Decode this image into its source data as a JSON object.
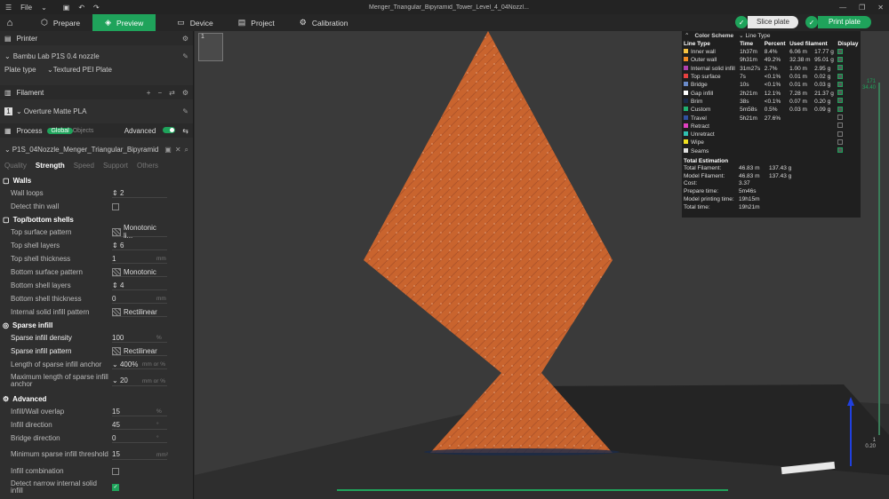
{
  "titlebar": {
    "file_label": "File",
    "title": "Menger_Triangular_Bipyramid_Tower_Level_4_04Nozzl..."
  },
  "nav": {
    "tabs": [
      {
        "label": "Prepare",
        "icon": "cube-icon"
      },
      {
        "label": "Preview",
        "icon": "preview-icon"
      },
      {
        "label": "Device",
        "icon": "device-icon"
      },
      {
        "label": "Project",
        "icon": "project-icon"
      },
      {
        "label": "Calibration",
        "icon": "calibration-icon"
      }
    ],
    "slice_label": "Slice plate",
    "print_label": "Print plate"
  },
  "printer": {
    "section_label": "Printer",
    "name": "Bambu Lab P1S 0.4 nozzle",
    "plate_type_label": "Plate type",
    "plate_type_value": "Textured PEI Plate"
  },
  "filament": {
    "section_label": "Filament",
    "slot": "1",
    "name": "Overture Matte PLA"
  },
  "process": {
    "section_label": "Process",
    "global_label": "Global",
    "objects_label": "Objects",
    "advanced_label": "Advanced",
    "preset": "P1S_04Nozzle_Menger_Triangular_Bipyramid",
    "tabs": [
      "Quality",
      "Strength",
      "Speed",
      "Support",
      "Others"
    ]
  },
  "params": {
    "walls": "Walls",
    "wall_loops": {
      "label": "Wall loops",
      "value": "2"
    },
    "detect_thin_wall": {
      "label": "Detect thin wall"
    },
    "top_bottom": "Top/bottom shells",
    "top_surface_pattern": {
      "label": "Top surface pattern",
      "value": "Monotonic li..."
    },
    "top_shell_layers": {
      "label": "Top shell layers",
      "value": "6"
    },
    "top_shell_thickness": {
      "label": "Top shell thickness",
      "value": "1",
      "unit": "mm"
    },
    "bottom_surface_pattern": {
      "label": "Bottom surface pattern",
      "value": "Monotonic"
    },
    "bottom_shell_layers": {
      "label": "Bottom shell layers",
      "value": "4"
    },
    "bottom_shell_thickness": {
      "label": "Bottom shell thickness",
      "value": "0",
      "unit": "mm"
    },
    "internal_solid_infill_pattern": {
      "label": "Internal solid infill pattern",
      "value": "Rectilinear"
    },
    "sparse_infill": "Sparse infill",
    "sparse_infill_density": {
      "label": "Sparse infill density",
      "value": "100",
      "unit": "%"
    },
    "sparse_infill_pattern": {
      "label": "Sparse infill pattern",
      "value": "Rectilinear"
    },
    "sparse_infill_anchor": {
      "label": "Length of sparse infill anchor",
      "value": "400%",
      "unit": "mm or %"
    },
    "max_sparse_anchor": {
      "label": "Maximum length of sparse infill anchor",
      "value": "20",
      "unit": "mm or %"
    },
    "advanced": "Advanced",
    "infill_wall_overlap": {
      "label": "Infill/Wall overlap",
      "value": "15",
      "unit": "%"
    },
    "infill_direction": {
      "label": "Infill direction",
      "value": "45",
      "unit": "°"
    },
    "bridge_direction": {
      "label": "Bridge direction",
      "value": "0",
      "unit": "°"
    },
    "min_sparse_threshold": {
      "label": "Minimum sparse infill threshold",
      "value": "15",
      "unit": "mm²"
    },
    "infill_combination": {
      "label": "Infill combination"
    },
    "detect_narrow": {
      "label": "Detect narrow internal solid infill"
    }
  },
  "viewport": {
    "plate_number": "1",
    "layer_top_a": "171",
    "layer_top_b": "34.40",
    "layer_bottom_a": "1",
    "layer_bottom_b": "0.20"
  },
  "legend": {
    "color_scheme_label": "Color Scheme",
    "scheme_value": "Line Type",
    "headers": [
      "Line Type",
      "Time",
      "Percent",
      "Used filament",
      "Display"
    ],
    "rows": [
      {
        "name": "Inner wall",
        "time": "1h37m",
        "percent": "8.4%",
        "len": "6.06 m",
        "weight": "17.77 g",
        "color": "#f5c242",
        "on": true
      },
      {
        "name": "Outer wall",
        "time": "9h31m",
        "percent": "49.2%",
        "len": "32.38 m",
        "weight": "95.01 g",
        "color": "#f08a24",
        "on": true
      },
      {
        "name": "Internal solid infill",
        "time": "31m27s",
        "percent": "2.7%",
        "len": "1.00 m",
        "weight": "2.95 g",
        "color": "#b040b0",
        "on": true
      },
      {
        "name": "Top surface",
        "time": "7s",
        "percent": "<0.1%",
        "len": "0.01 m",
        "weight": "0.02 g",
        "color": "#e84040",
        "on": true
      },
      {
        "name": "Bridge",
        "time": "10s",
        "percent": "<0.1%",
        "len": "0.01 m",
        "weight": "0.03 g",
        "color": "#6a8ac8",
        "on": true
      },
      {
        "name": "Gap infill",
        "time": "2h21m",
        "percent": "12.1%",
        "len": "7.28 m",
        "weight": "21.37 g",
        "color": "#ffffff",
        "on": true
      },
      {
        "name": "Brim",
        "time": "38s",
        "percent": "<0.1%",
        "len": "0.07 m",
        "weight": "0.20 g",
        "color": "#1a2a4a",
        "on": true
      },
      {
        "name": "Custom",
        "time": "5m58s",
        "percent": "0.5%",
        "len": "0.03 m",
        "weight": "0.09 g",
        "color": "#20b070",
        "on": true
      },
      {
        "name": "Travel",
        "time": "5h21m",
        "percent": "27.6%",
        "len": "",
        "weight": "",
        "color": "#3050a0",
        "on": false
      },
      {
        "name": "Retract",
        "time": "",
        "percent": "",
        "len": "",
        "weight": "",
        "color": "#e040c0",
        "on": false
      },
      {
        "name": "Unretract",
        "time": "",
        "percent": "",
        "len": "",
        "weight": "",
        "color": "#30c0b0",
        "on": false
      },
      {
        "name": "Wipe",
        "time": "",
        "percent": "",
        "len": "",
        "weight": "",
        "color": "#f0e020",
        "on": false
      },
      {
        "name": "Seams",
        "time": "",
        "percent": "",
        "len": "",
        "weight": "",
        "color": "#e0e0e0",
        "on": true
      }
    ],
    "estimation_title": "Total Estimation",
    "estimation": [
      {
        "k": "Total Filament:",
        "v1": "46.83 m",
        "v2": "137.43 g"
      },
      {
        "k": "Model Filament:",
        "v1": "46.83 m",
        "v2": "137.43 g"
      },
      {
        "k": "Cost:",
        "v1": "3.37",
        "v2": ""
      },
      {
        "k": "Prepare time:",
        "v1": "5m46s",
        "v2": ""
      },
      {
        "k": "Model printing time:",
        "v1": "19h15m",
        "v2": ""
      },
      {
        "k": "Total time:",
        "v1": "19h21m",
        "v2": ""
      }
    ]
  },
  "colors": {
    "accent": "#1fa35b",
    "model": "#c9642e"
  }
}
